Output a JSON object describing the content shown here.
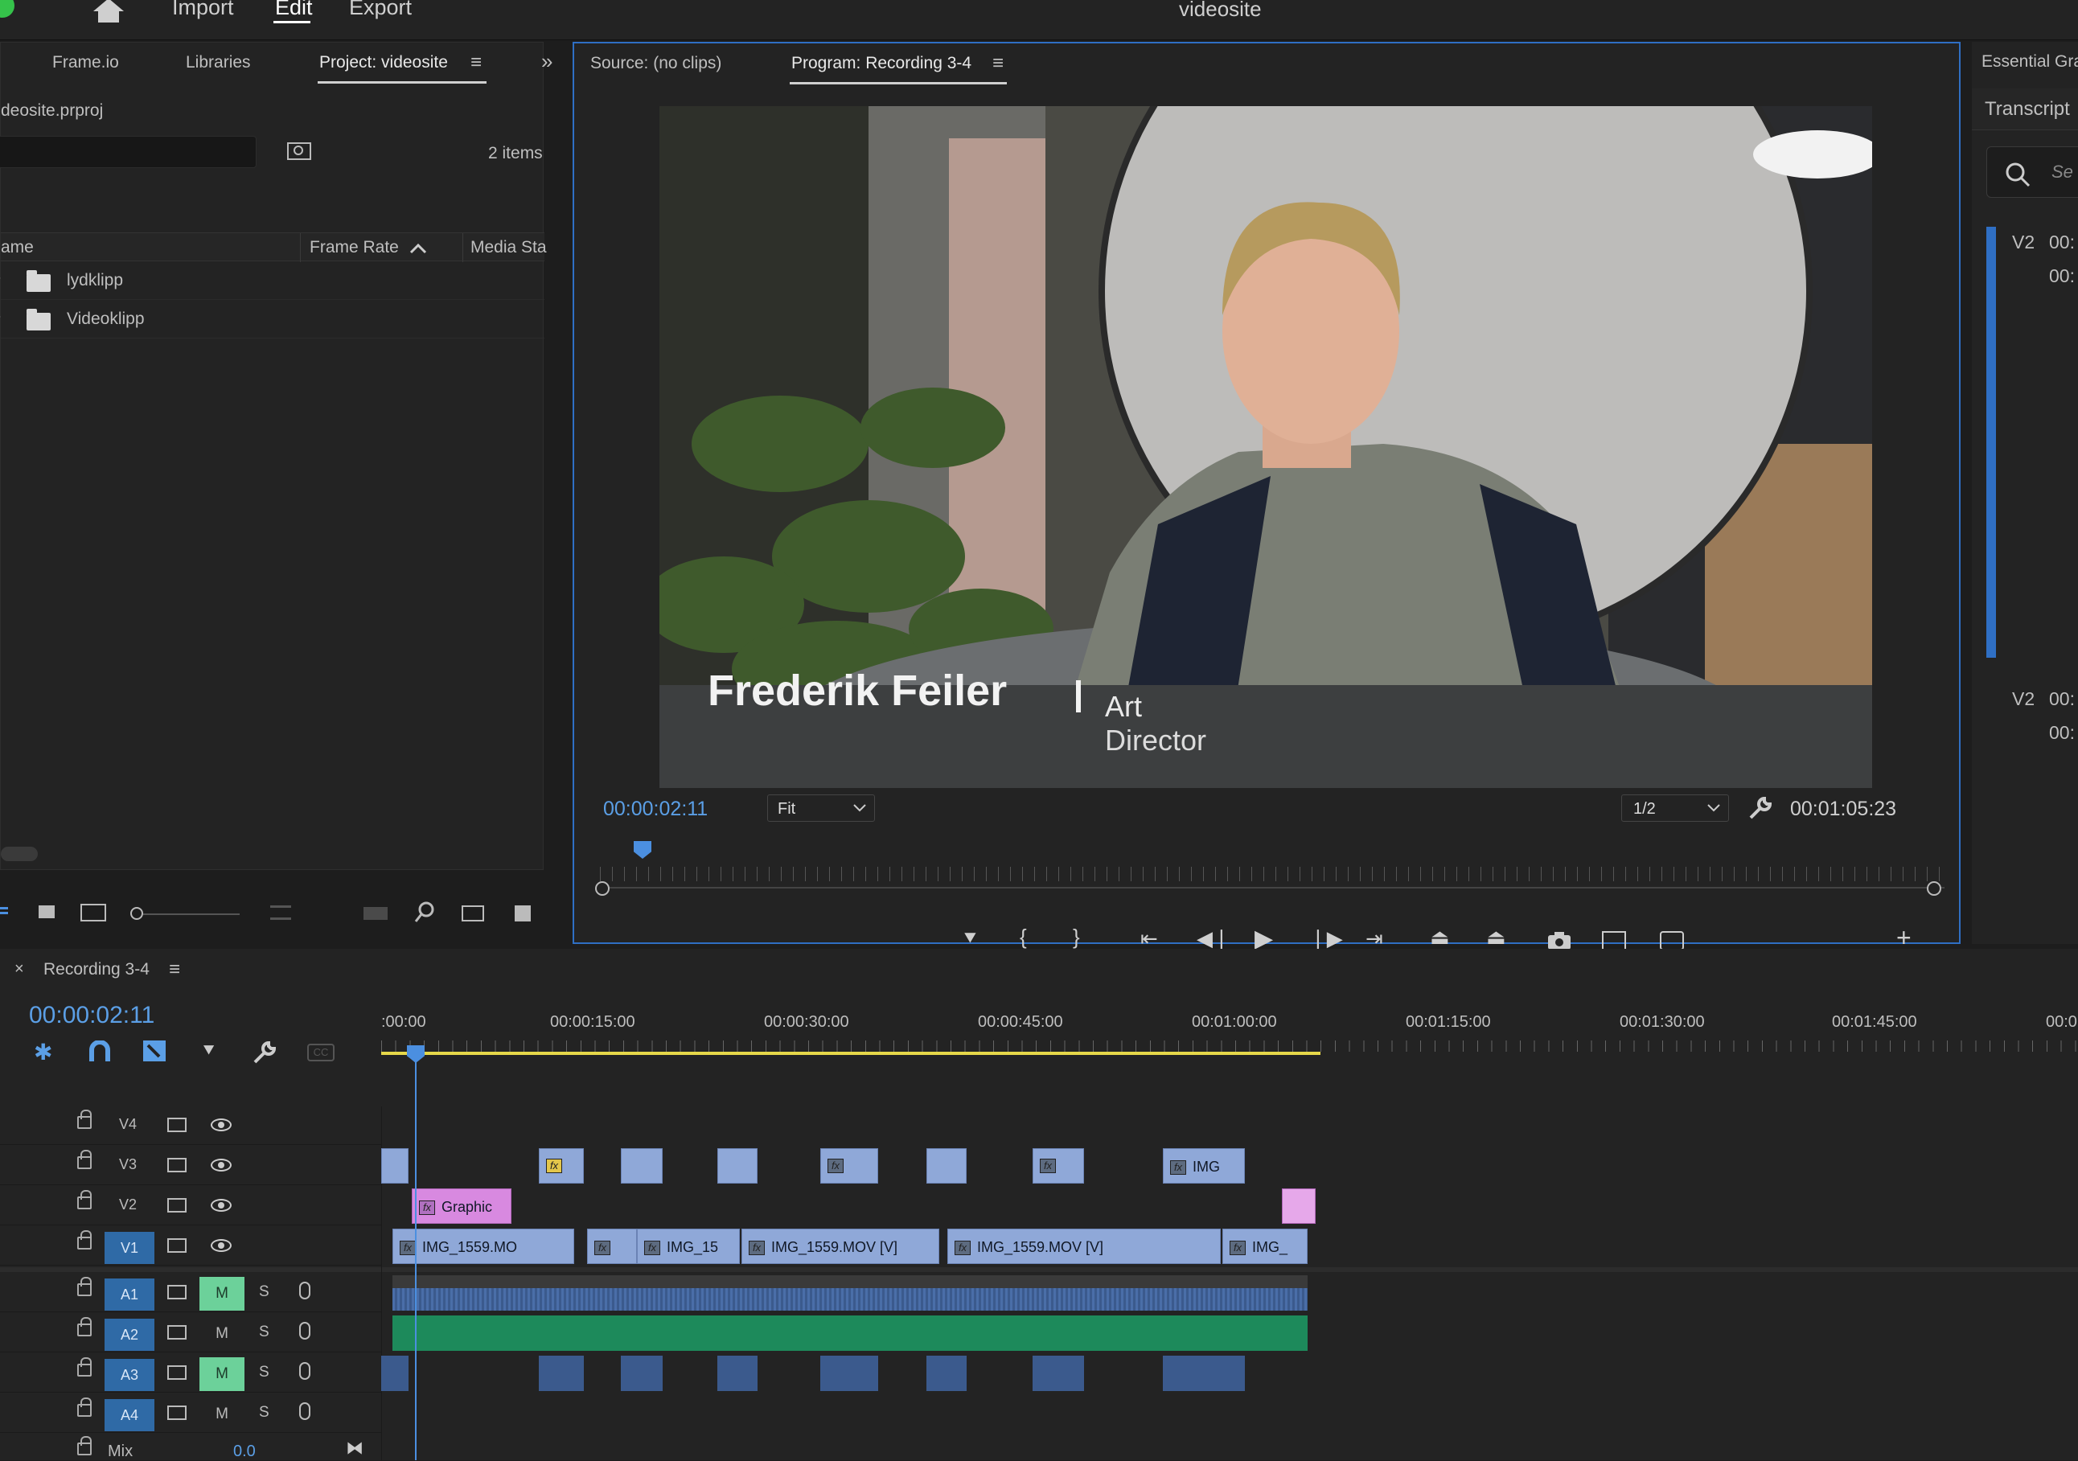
{
  "app": {
    "title": "videosite",
    "nav": [
      "Import",
      "Edit",
      "Export"
    ],
    "active_nav": "Edit"
  },
  "project_panel": {
    "tabs": [
      "Frame.io",
      "Libraries",
      "Project: videosite"
    ],
    "file": "deosite.prproj",
    "items_count": "2 items",
    "columns": [
      "ame",
      "Frame Rate",
      "Media Sta"
    ],
    "rows": [
      {
        "name": "lydklipp"
      },
      {
        "name": "Videoklipp"
      }
    ]
  },
  "monitor": {
    "source_tab": "Source: (no clips)",
    "program_tab": "Program: Recording 3-4",
    "timecode": "00:00:02:11",
    "fit": "Fit",
    "resolution": "1/2",
    "duration": "00:01:05:23",
    "lower_third": {
      "name": "Frederik Feiler",
      "role_line1": "Art",
      "role_line2": "Director"
    }
  },
  "essential": {
    "tab": "Essential Gra",
    "transcript": "Transcript",
    "search_placeholder": "Se",
    "entries": [
      {
        "track": "V2",
        "t1": "00:",
        "t2": "00:"
      },
      {
        "track": "V2",
        "t1": "00:",
        "t2": "00:"
      }
    ]
  },
  "timeline": {
    "sequence": "Recording 3-4",
    "timecode": "00:00:02:11",
    "ruler": [
      ":00:00",
      "00:00:15:00",
      "00:00:30:00",
      "00:00:45:00",
      "00:01:00:00",
      "00:01:15:00",
      "00:01:30:00",
      "00:01:45:00",
      "00:0"
    ],
    "tracks": [
      "V4",
      "V3",
      "V2",
      "V1",
      "A1",
      "A2",
      "A3",
      "A4"
    ],
    "mix_label": "Mix",
    "mix_value": "0.0",
    "clips": {
      "v3_last": "IMG",
      "v2_graphic": "Graphic",
      "v1": [
        "IMG_1559.MO",
        "IMG_15",
        "IMG_1559.MOV [V]",
        "IMG_1559.MOV [V]",
        "IMG_"
      ]
    }
  },
  "colors": {
    "accent": "#2f6fc4",
    "timecode": "#5b9fe6",
    "video_clip": "#8fa8d8",
    "graphic_clip": "#d889e0",
    "audio_green": "#1d8a5b",
    "mute_on": "#6cd19a"
  }
}
